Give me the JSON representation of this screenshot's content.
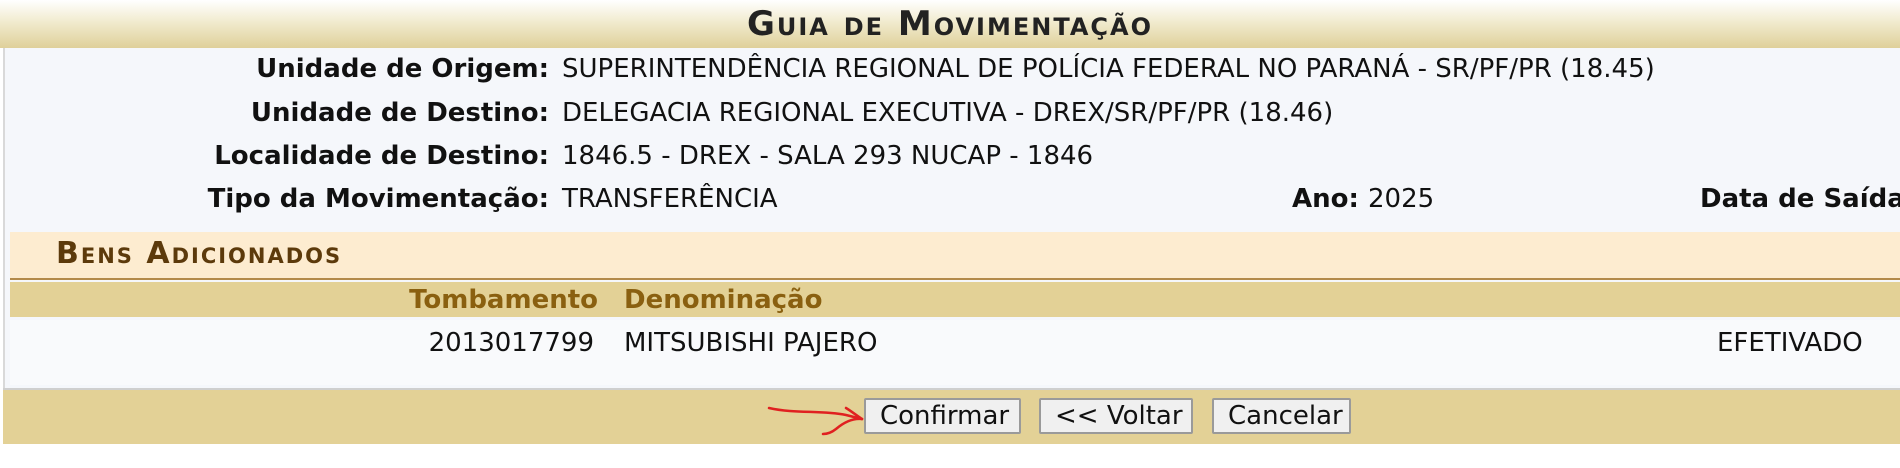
{
  "page": {
    "title": "Guia de Movimentação"
  },
  "info": {
    "unidade_origem_label": "Unidade de Origem:",
    "unidade_origem_value": "SUPERINTENDÊNCIA REGIONAL DE POLÍCIA FEDERAL NO PARANÁ - SR/PF/PR (18.45)",
    "unidade_destino_label": "Unidade de Destino:",
    "unidade_destino_value": "DELEGACIA REGIONAL EXECUTIVA - DREX/SR/PF/PR (18.46)",
    "localidade_destino_label": "Localidade de Destino:",
    "localidade_destino_value": "1846.5 - DREX - SALA 293 NUCAP - 1846",
    "tipo_movimentacao_label": "Tipo da Movimentação:",
    "tipo_movimentacao_value": "TRANSFERÊNCIA",
    "ano_label": "Ano:",
    "ano_value": "2025",
    "data_saida_label": "Data de Saída"
  },
  "bens": {
    "section_title": "Bens Adicionados",
    "columns": {
      "tombamento": "Tombamento",
      "denominacao": "Denominação"
    },
    "rows": [
      {
        "tombamento": "2013017799",
        "denominacao": "MITSUBISHI PAJERO",
        "status": "EFETIVADO"
      }
    ]
  },
  "footer": {
    "confirmar_label": "Confirmar",
    "voltar_label": "<< Voltar",
    "cancelar_label": "Cancelar"
  },
  "colors": {
    "header_gold": "#e3d196",
    "section_bg": "#fdecd0",
    "section_title": "#5c3a0b",
    "column_header_text": "#8a6010",
    "annotation_arrow": "#e02020"
  },
  "icons": {
    "annotation": "red-hand-drawn-arrow"
  }
}
